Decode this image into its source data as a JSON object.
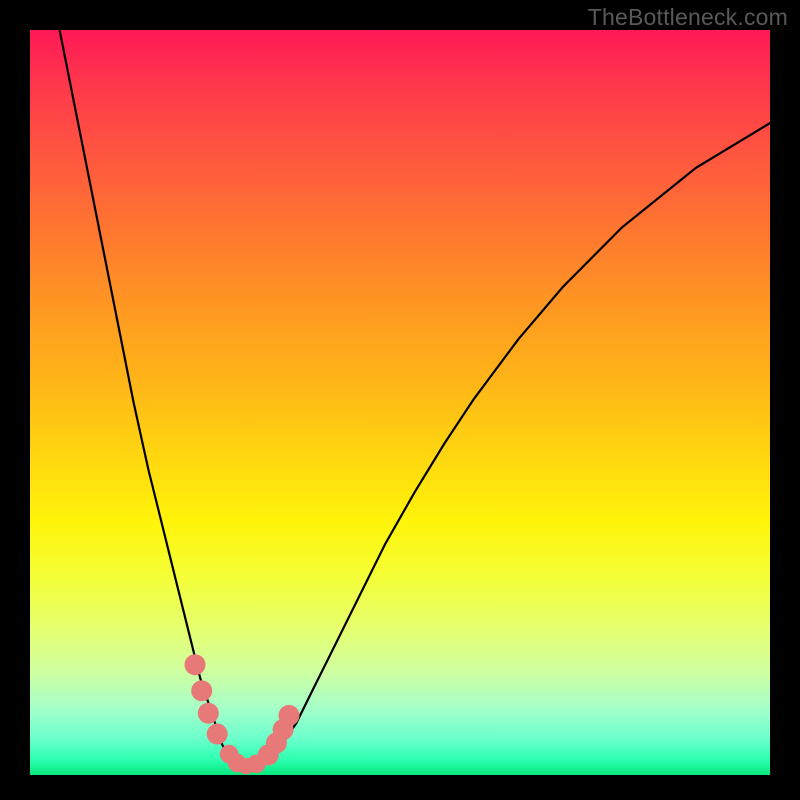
{
  "watermark": "TheBottleneck.com",
  "chart_data": {
    "type": "line",
    "title": "",
    "xlabel": "",
    "ylabel": "",
    "xlim": [
      0,
      100
    ],
    "ylim": [
      0,
      100
    ],
    "grid": false,
    "legend": false,
    "series": [
      {
        "name": "curve",
        "x": [
          4,
          6,
          8,
          10,
          12,
          14,
          16,
          18,
          20,
          22,
          23,
          24,
          25,
          26,
          27,
          28,
          29,
          30,
          31,
          32,
          34,
          36,
          38,
          40,
          44,
          48,
          52,
          56,
          60,
          66,
          72,
          80,
          90,
          100
        ],
        "y": [
          100,
          90,
          80,
          70,
          60,
          50,
          41,
          33,
          25,
          17,
          13,
          10,
          7,
          4,
          2.5,
          1.5,
          1,
          1,
          1.3,
          2,
          4,
          7,
          11,
          15,
          23,
          31,
          38,
          44.5,
          50.5,
          58.5,
          65.5,
          73.5,
          81.5,
          87.5
        ]
      }
    ],
    "markers": [
      {
        "x": 22.3,
        "y": 14.8,
        "r": 1.7
      },
      {
        "x": 23.2,
        "y": 11.3,
        "r": 1.7
      },
      {
        "x": 24.1,
        "y": 8.3,
        "r": 1.7
      },
      {
        "x": 25.3,
        "y": 5.5,
        "r": 1.7
      },
      {
        "x": 26.9,
        "y": 2.8,
        "r": 1.5
      },
      {
        "x": 28.0,
        "y": 1.6,
        "r": 1.5
      },
      {
        "x": 29.2,
        "y": 1.2,
        "r": 1.3
      },
      {
        "x": 30.6,
        "y": 1.5,
        "r": 1.5
      },
      {
        "x": 32.2,
        "y": 2.7,
        "r": 1.7
      },
      {
        "x": 33.3,
        "y": 4.3,
        "r": 1.7
      },
      {
        "x": 34.2,
        "y": 6.1,
        "r": 1.7
      },
      {
        "x": 35.0,
        "y": 8.0,
        "r": 1.7
      }
    ],
    "background_gradient": {
      "top": "#ff1956",
      "mid": "#ffd610",
      "bottom": "#05e87e"
    }
  }
}
